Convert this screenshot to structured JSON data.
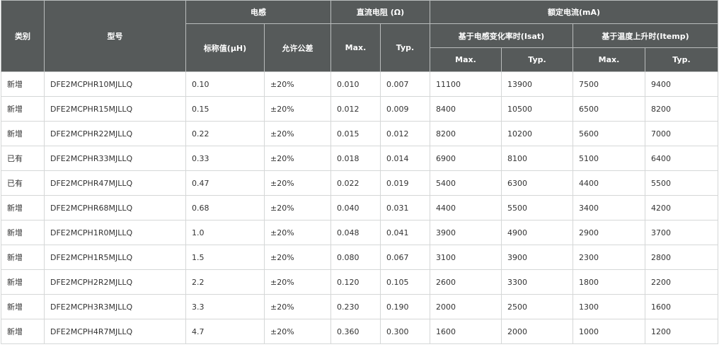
{
  "header": {
    "category": "类别",
    "model": "型号",
    "inductance": "电感",
    "dc_resistance": "直流电阻 (Ω)",
    "rated_current": "额定电流(mA)",
    "nominal": "标称值(μH)",
    "tolerance": "允许公差",
    "max": "Max.",
    "typ": "Typ.",
    "isat": "基于电感变化率时(Isat)",
    "itemp": "基于温度上升时(Itemp)"
  },
  "rows": [
    {
      "category": "新增",
      "model": "DFE2MCPHR10MJLLQ",
      "inductance": "0.10",
      "tolerance": "±20%",
      "rdc_max": "0.010",
      "rdc_typ": "0.007",
      "isat_max": "11100",
      "isat_typ": "13900",
      "itemp_max": "7500",
      "itemp_typ": "9400"
    },
    {
      "category": "新增",
      "model": "DFE2MCPHR15MJLLQ",
      "inductance": "0.15",
      "tolerance": "±20%",
      "rdc_max": "0.012",
      "rdc_typ": "0.009",
      "isat_max": "8400",
      "isat_typ": "10500",
      "itemp_max": "6500",
      "itemp_typ": "8200"
    },
    {
      "category": "新增",
      "model": "DFE2MCPHR22MJLLQ",
      "inductance": "0.22",
      "tolerance": "±20%",
      "rdc_max": "0.015",
      "rdc_typ": "0.012",
      "isat_max": "8200",
      "isat_typ": "10200",
      "itemp_max": "5600",
      "itemp_typ": "7000"
    },
    {
      "category": "已有",
      "model": "DFE2MCPHR33MJLLQ",
      "inductance": "0.33",
      "tolerance": "±20%",
      "rdc_max": "0.018",
      "rdc_typ": "0.014",
      "isat_max": "6900",
      "isat_typ": "8100",
      "itemp_max": "5100",
      "itemp_typ": "6400"
    },
    {
      "category": "已有",
      "model": "DFE2MCPHR47MJLLQ",
      "inductance": "0.47",
      "tolerance": "±20%",
      "rdc_max": "0.022",
      "rdc_typ": "0.019",
      "isat_max": "5400",
      "isat_typ": "6300",
      "itemp_max": "4400",
      "itemp_typ": "5500"
    },
    {
      "category": "新增",
      "model": "DFE2MCPHR68MJLLQ",
      "inductance": "0.68",
      "tolerance": "±20%",
      "rdc_max": "0.040",
      "rdc_typ": "0.031",
      "isat_max": "4400",
      "isat_typ": "5500",
      "itemp_max": "3400",
      "itemp_typ": "4200"
    },
    {
      "category": "新增",
      "model": "DFE2MCPH1R0MJLLQ",
      "inductance": "1.0",
      "tolerance": "±20%",
      "rdc_max": "0.048",
      "rdc_typ": "0.041",
      "isat_max": "3900",
      "isat_typ": "4900",
      "itemp_max": "2900",
      "itemp_typ": "3700"
    },
    {
      "category": "新增",
      "model": "DFE2MCPH1R5MJLLQ",
      "inductance": "1.5",
      "tolerance": "±20%",
      "rdc_max": "0.080",
      "rdc_typ": "0.067",
      "isat_max": "3100",
      "isat_typ": "3900",
      "itemp_max": "2300",
      "itemp_typ": "2800"
    },
    {
      "category": "新增",
      "model": "DFE2MCPH2R2MJLLQ",
      "inductance": "2.2",
      "tolerance": "±20%",
      "rdc_max": "0.120",
      "rdc_typ": "0.105",
      "isat_max": "2600",
      "isat_typ": "3300",
      "itemp_max": "1800",
      "itemp_typ": "2200"
    },
    {
      "category": "新增",
      "model": "DFE2MCPH3R3MJLLQ",
      "inductance": "3.3",
      "tolerance": "±20%",
      "rdc_max": "0.230",
      "rdc_typ": "0.190",
      "isat_max": "2000",
      "isat_typ": "2500",
      "itemp_max": "1300",
      "itemp_typ": "1600"
    },
    {
      "category": "新增",
      "model": "DFE2MCPH4R7MJLLQ",
      "inductance": "4.7",
      "tolerance": "±20%",
      "rdc_max": "0.360",
      "rdc_typ": "0.300",
      "isat_max": "1600",
      "isat_typ": "2000",
      "itemp_max": "1000",
      "itemp_typ": "1200"
    }
  ]
}
